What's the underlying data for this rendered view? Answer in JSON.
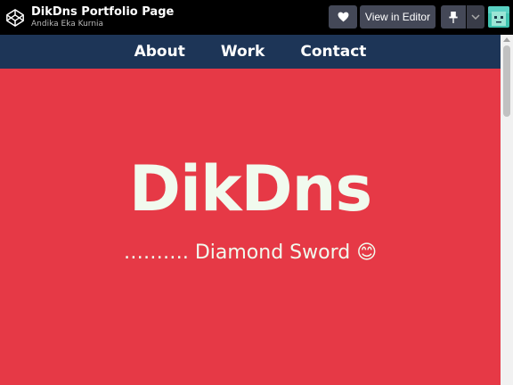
{
  "header": {
    "pen_title": "DikDns Portfolio Page",
    "author": "Andika Eka Kurnia",
    "view_in_editor": "View in Editor",
    "icons": [
      "codepen-logo-icon",
      "heart-icon",
      "pin-icon",
      "chevron-down-icon",
      "avatar"
    ]
  },
  "nav": {
    "items": [
      {
        "label": "About"
      },
      {
        "label": "Work"
      },
      {
        "label": "Contact"
      }
    ]
  },
  "hero": {
    "title": "DikDns",
    "subtitle": "………. Diamond Sword 😊"
  },
  "colors": {
    "hero_bg": "#e63946",
    "nav_bg": "#1d3557",
    "text_light": "#f1faee",
    "topbar_bg": "#000000",
    "button_bg": "#444857"
  }
}
